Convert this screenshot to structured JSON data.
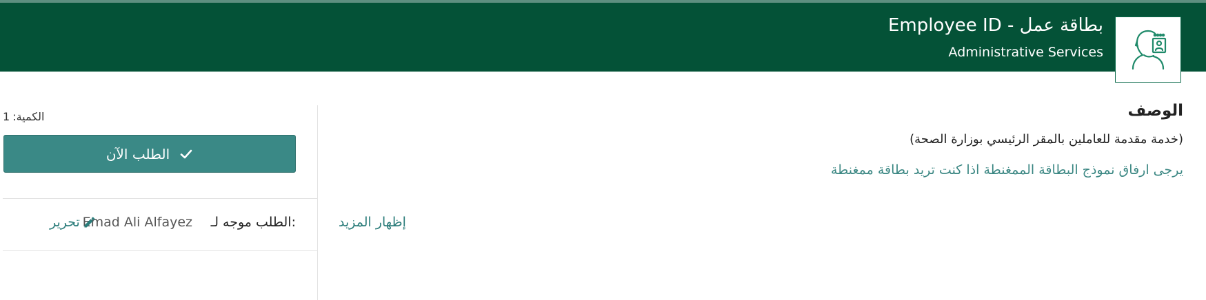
{
  "header": {
    "title": "Employee ID - بطاقة عمل",
    "subtitle": "Administrative Services",
    "logo_icon": "employee-id-icon",
    "background_color": "#045237"
  },
  "description": {
    "heading": "الوصف",
    "line1": "(خدمة مقدمة للعاملين بالمقر الرئيسي بوزارة الصحة)",
    "line2": "يرجى ارفاق نموذج البطاقة الممغنطة اذا كنت تريد بطاقة ممغنطة",
    "show_more": "إظهار المزيد"
  },
  "order": {
    "quantity_label": "الكمية:",
    "quantity_value": "1",
    "button_label": "الطلب الآن",
    "button_icon": "checkmark-icon",
    "button_color": "#3a8986"
  },
  "request": {
    "directed_to_label": "الطلب موجه لـ:",
    "directed_to_name": "Emad Ali Alfayez",
    "edit_label": "تحرير",
    "edit_icon": "pencil-icon"
  }
}
